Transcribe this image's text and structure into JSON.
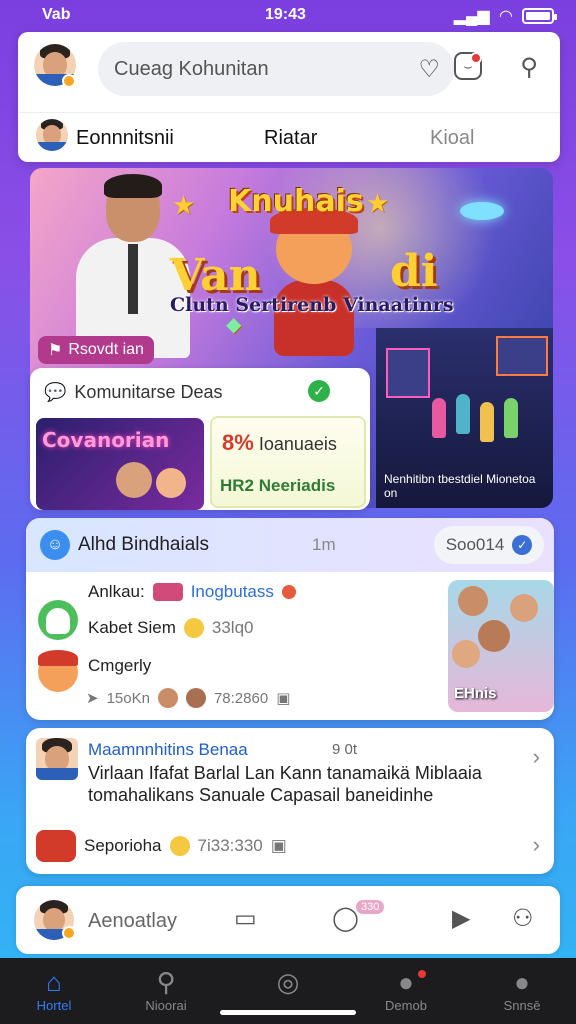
{
  "status": {
    "carrier": "Vab",
    "time": "19:43"
  },
  "header": {
    "search_placeholder": "Cueag Kohunitan",
    "tabs": [
      "Eonnnitsnii",
      "Riatar",
      "Kioal"
    ]
  },
  "hero": {
    "title_top": "Knuhais",
    "title_left": "Van",
    "title_right": "di",
    "subtitle": "Clutn Sertirenb Vinaatinrs",
    "chip_label": "Rsovdt ian",
    "room_caption": "Nenhitibn tbestdiel Mionetoa on"
  },
  "community": {
    "title": "Komunitarse Deas",
    "thumb_text": "Covanorian",
    "stat_pct": "8%",
    "stat_label": "Ioanuaeis",
    "stat_tag": "HR2 Neeriadis"
  },
  "alhad": {
    "title": "Alhd Bindhaials",
    "time": "1m",
    "pill_label": "Soo014",
    "row1_name": "Anlkau:",
    "row1_tag": "Inogbutass",
    "row2_text": "Kabet Siem",
    "row2_count": "33lq0",
    "row3_text": "Cmgerly",
    "row4_views": "15oKn",
    "row4_likes": "78:2860",
    "photo_label": "EHnis"
  },
  "feed": {
    "name": "Maamnnhitins Benaa",
    "time": "9 0t",
    "body": "Virlaan Ifafat Barlal Lan Kann tanamaikä Miblaaia tomahalikans Sanuale Capasail baneidinhe",
    "footer_name": "Seporioha",
    "footer_count": "7i33:330"
  },
  "composer": {
    "placeholder": "Aenoatlay",
    "badge": "330"
  },
  "nav": [
    {
      "label": "Hortel",
      "icon": "home-icon"
    },
    {
      "label": "Nioorai",
      "icon": "search-icon"
    },
    {
      "label": "",
      "icon": "chat-icon"
    },
    {
      "label": "Demob",
      "icon": "bell-icon"
    },
    {
      "label": "Snnsē",
      "icon": "profile-icon"
    }
  ],
  "colors": {
    "accent": "#2f7cf6",
    "bg_top": "#7b3fe0",
    "bg_bottom": "#2fb8f3"
  }
}
